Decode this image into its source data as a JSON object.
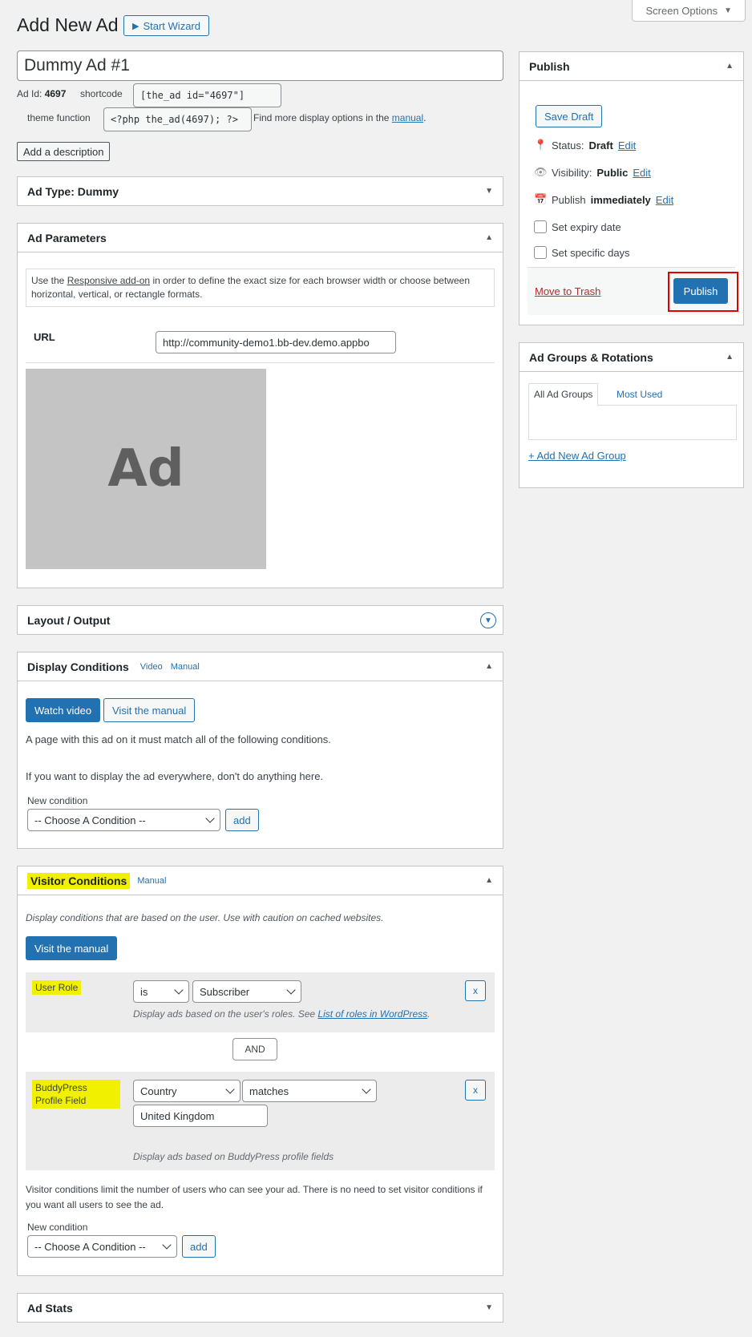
{
  "header": {
    "screen_options": "Screen Options",
    "page_title": "Add New Ad",
    "start_wizard": "Start Wizard"
  },
  "post": {
    "title": "Dummy Ad #1",
    "ad_id_label": "Ad Id:",
    "ad_id": "4697",
    "shortcode_label": "shortcode",
    "shortcode": "[the_ad id=\"4697\"]",
    "theme_function_label": "theme function",
    "theme_function": "<?php the_ad(4697); ?>",
    "more_options_text": "Find more display options in the",
    "manual_link": "manual",
    "add_description": "Add a description"
  },
  "ad_type_box": {
    "title": "Ad Type: Dummy"
  },
  "ad_parameters": {
    "title": "Ad Parameters",
    "notice_pre": "Use the ",
    "notice_link": "Responsive add-on",
    "notice_post": " in order to define the exact size for each browser width or choose between horizontal, vertical, or rectangle formats.",
    "url_label": "URL",
    "url_value": "http://community-demo1.bb-dev.demo.appbo",
    "ad_preview_text": "Ad"
  },
  "layout_box": {
    "title": "Layout / Output"
  },
  "display_conditions": {
    "title": "Display Conditions",
    "video_link": "Video",
    "manual_link": "Manual",
    "watch_video": "Watch video",
    "visit_manual": "Visit the manual",
    "text1": "A page with this ad on it must match all of the following conditions.",
    "text2": "If you want to display the ad everywhere, don't do anything here.",
    "new_condition_label": "New condition",
    "select_value": "-- Choose A Condition --",
    "add": "add"
  },
  "visitor_conditions": {
    "title": "Visitor Conditions",
    "manual_link": "Manual",
    "intro": "Display conditions that are based on the user. Use with caution on cached websites.",
    "visit_manual": "Visit the manual",
    "user_role": {
      "label": "User Role",
      "operator": "is",
      "value": "Subscriber",
      "desc_pre": "Display ads based on the user's roles. See ",
      "desc_link": "List of roles in WordPress",
      "desc_post": ".",
      "remove": "x"
    },
    "and_label": "AND",
    "buddypress": {
      "label": "BuddyPress Profile Field",
      "field": "Country",
      "operator": "matches",
      "value": "United Kingdom",
      "desc": "Display ads based on BuddyPress profile fields",
      "remove": "x"
    },
    "footer_text": "Visitor conditions limit the number of users who can see your ad. There is no need to set visitor conditions if you want all users to see the ad.",
    "new_condition_label": "New condition",
    "select_value": "-- Choose A Condition --",
    "add": "add"
  },
  "ad_stats": {
    "title": "Ad Stats"
  },
  "publish": {
    "title": "Publish",
    "save_draft": "Save Draft",
    "status_label": "Status:",
    "status_value": "Draft",
    "visibility_label": "Visibility:",
    "visibility_value": "Public",
    "publish_label": "Publish",
    "publish_value": "immediately",
    "edit": "Edit",
    "expiry": "Set expiry date",
    "specific_days": "Set specific days",
    "move_to_trash": "Move to Trash",
    "publish_button": "Publish"
  },
  "ad_groups": {
    "title": "Ad Groups & Rotations",
    "tab_all": "All Ad Groups",
    "tab_most_used": "Most Used",
    "add_new": "+ Add New Ad Group"
  },
  "colors": {
    "accent": "#2271b1",
    "highlight": "#f0f000",
    "trash": "#b32d2e",
    "annotation_box": "#e00000"
  }
}
